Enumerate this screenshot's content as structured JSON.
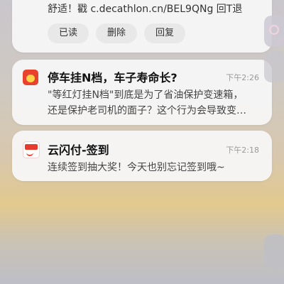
{
  "notif1": {
    "body": "舒适！戳 c.decathlon.cn/BEL9QNg 回T退",
    "actions": [
      "已读",
      "删除",
      "回复"
    ]
  },
  "notif2": {
    "title": "停车挂N档，车子寿命长?",
    "time": "下午2:26",
    "line1": "\"等红灯挂N档\"到底是为了省油保护变速箱，",
    "line2": "还是保护老司机的面子？这个行为会导致变…",
    "icon": "car-news-app-icon"
  },
  "notif3": {
    "title": "云闪付-签到",
    "time": "下午2:18",
    "line1": "连续签到抽大奖！今天也别忘记签到哦~",
    "icon": "yunshanfu-app-icon"
  },
  "colors": {
    "card_bg": "#f8f8f8",
    "accent_red": "#e63a2e"
  }
}
